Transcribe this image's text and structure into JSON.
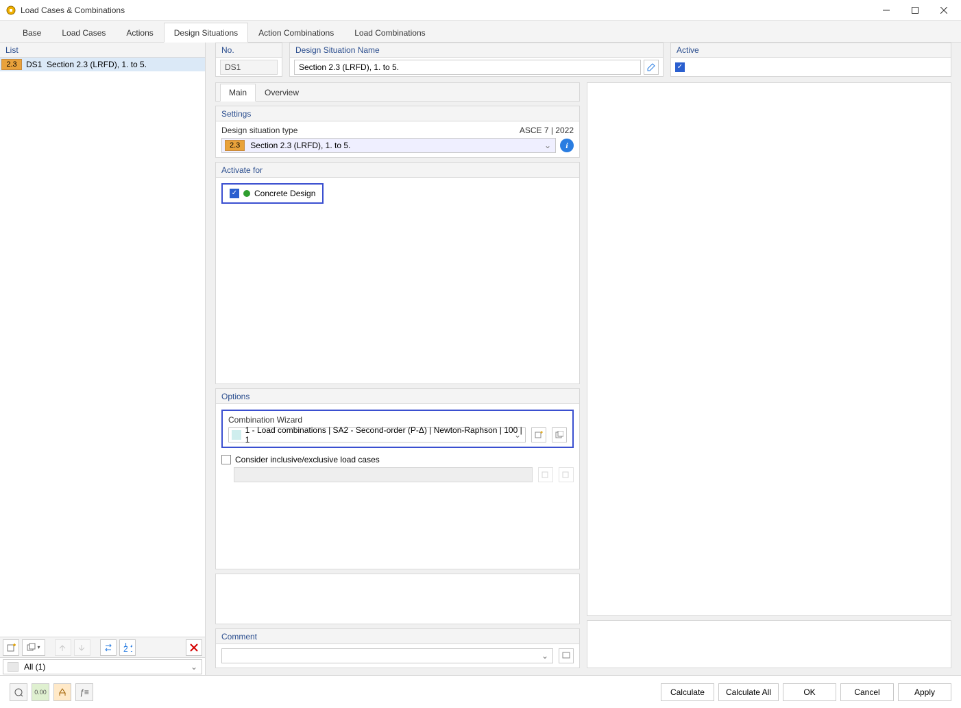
{
  "window": {
    "title": "Load Cases & Combinations"
  },
  "tabs": {
    "base": "Base",
    "load_cases": "Load Cases",
    "actions": "Actions",
    "design_situations": "Design Situations",
    "action_combinations": "Action Combinations",
    "load_combinations": "Load Combinations"
  },
  "left": {
    "header": "List",
    "row": {
      "badge": "2.3",
      "id": "DS1",
      "desc": "Section 2.3 (LRFD), 1. to 5."
    },
    "filter": "All (1)"
  },
  "fields": {
    "no_header": "No.",
    "no_value": "DS1",
    "name_header": "Design Situation Name",
    "name_value": "Section 2.3 (LRFD), 1. to 5.",
    "active_header": "Active"
  },
  "subtabs": {
    "main": "Main",
    "overview": "Overview"
  },
  "settings": {
    "header": "Settings",
    "type_label": "Design situation type",
    "standard": "ASCE 7 | 2022",
    "dd_badge": "2.3",
    "dd_text": "Section 2.3 (LRFD), 1. to 5."
  },
  "activate": {
    "header": "Activate for",
    "concrete": "Concrete Design"
  },
  "options": {
    "header": "Options",
    "wizard_label": "Combination Wizard",
    "wizard_value": "1 - Load combinations | SA2 - Second-order (P-Δ) | Newton-Raphson | 100 | 1",
    "consider_label": "Consider inclusive/exclusive load cases"
  },
  "comment": {
    "header": "Comment"
  },
  "footer": {
    "calculate": "Calculate",
    "calculate_all": "Calculate All",
    "ok": "OK",
    "cancel": "Cancel",
    "apply": "Apply"
  }
}
